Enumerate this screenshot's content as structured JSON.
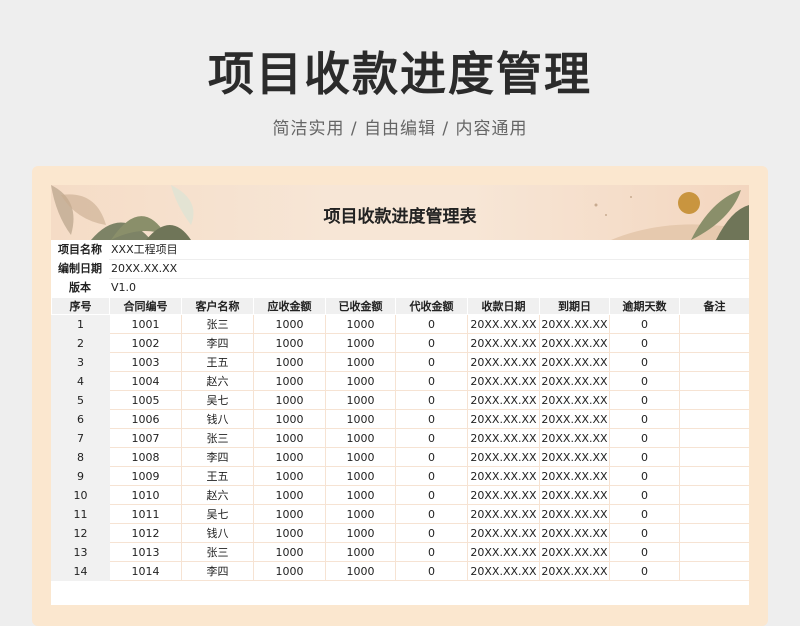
{
  "title": "项目收款进度管理",
  "subtitle": "简洁实用 / 自由编辑 / 内容通用",
  "sheet_title": "项目收款进度管理表",
  "meta": [
    {
      "label": "项目名称",
      "value": "XXX工程项目"
    },
    {
      "label": "编制日期",
      "value": "20XX.XX.XX"
    },
    {
      "label": "版本",
      "value": "V1.0"
    }
  ],
  "columns": [
    "序号",
    "合同编号",
    "客户名称",
    "应收金额",
    "已收金额",
    "代收金额",
    "收款日期",
    "到期日",
    "逾期天数",
    "备注"
  ],
  "rows": [
    [
      "1",
      "1001",
      "张三",
      "1000",
      "1000",
      "0",
      "20XX.XX.XX",
      "20XX.XX.XX",
      "0",
      ""
    ],
    [
      "2",
      "1002",
      "李四",
      "1000",
      "1000",
      "0",
      "20XX.XX.XX",
      "20XX.XX.XX",
      "0",
      ""
    ],
    [
      "3",
      "1003",
      "王五",
      "1000",
      "1000",
      "0",
      "20XX.XX.XX",
      "20XX.XX.XX",
      "0",
      ""
    ],
    [
      "4",
      "1004",
      "赵六",
      "1000",
      "1000",
      "0",
      "20XX.XX.XX",
      "20XX.XX.XX",
      "0",
      ""
    ],
    [
      "5",
      "1005",
      "吴七",
      "1000",
      "1000",
      "0",
      "20XX.XX.XX",
      "20XX.XX.XX",
      "0",
      ""
    ],
    [
      "6",
      "1006",
      "钱八",
      "1000",
      "1000",
      "0",
      "20XX.XX.XX",
      "20XX.XX.XX",
      "0",
      ""
    ],
    [
      "7",
      "1007",
      "张三",
      "1000",
      "1000",
      "0",
      "20XX.XX.XX",
      "20XX.XX.XX",
      "0",
      ""
    ],
    [
      "8",
      "1008",
      "李四",
      "1000",
      "1000",
      "0",
      "20XX.XX.XX",
      "20XX.XX.XX",
      "0",
      ""
    ],
    [
      "9",
      "1009",
      "王五",
      "1000",
      "1000",
      "0",
      "20XX.XX.XX",
      "20XX.XX.XX",
      "0",
      ""
    ],
    [
      "10",
      "1010",
      "赵六",
      "1000",
      "1000",
      "0",
      "20XX.XX.XX",
      "20XX.XX.XX",
      "0",
      ""
    ],
    [
      "11",
      "1011",
      "吴七",
      "1000",
      "1000",
      "0",
      "20XX.XX.XX",
      "20XX.XX.XX",
      "0",
      ""
    ],
    [
      "12",
      "1012",
      "钱八",
      "1000",
      "1000",
      "0",
      "20XX.XX.XX",
      "20XX.XX.XX",
      "0",
      ""
    ],
    [
      "13",
      "1013",
      "张三",
      "1000",
      "1000",
      "0",
      "20XX.XX.XX",
      "20XX.XX.XX",
      "0",
      ""
    ],
    [
      "14",
      "1014",
      "李四",
      "1000",
      "1000",
      "0",
      "20XX.XX.XX",
      "20XX.XX.XX",
      "0",
      ""
    ]
  ],
  "colors": {
    "frame": "#fbe7cf",
    "banner": "#f7e6d6",
    "leaf": "#8a8f6a",
    "sun": "#c9953f"
  }
}
